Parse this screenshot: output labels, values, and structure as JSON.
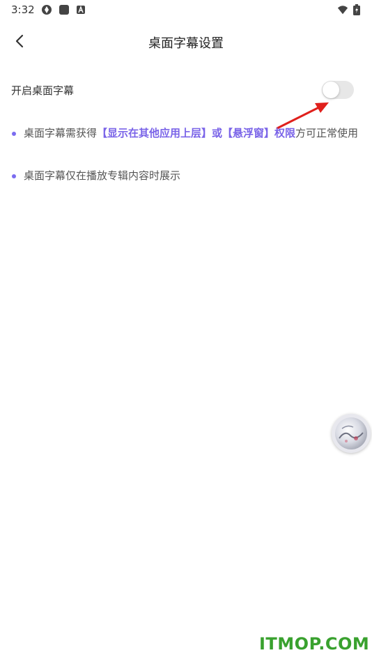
{
  "status_bar": {
    "time": "3:32",
    "icons": [
      "aperture-icon",
      "square-icon",
      "a-icon",
      "wifi-icon",
      "battery-charging-icon"
    ]
  },
  "header": {
    "title": "桌面字幕设置",
    "back_icon": "chevron-left-icon"
  },
  "setting": {
    "label": "开启桌面字幕",
    "toggle_on": false
  },
  "notes": [
    {
      "prefix": "桌面字幕需获得",
      "highlight": "【显示在其他应用上层】或【悬浮窗】权限",
      "suffix": "方可正常使用"
    },
    {
      "text": "桌面字幕仅在播放专辑内容时展示"
    }
  ],
  "watermark": "ITMOP.COM",
  "colors": {
    "accent": "#7a64e8",
    "arrow": "#e0201c",
    "watermark": "#39a12e",
    "toggle_track": "#e7e7e7"
  }
}
